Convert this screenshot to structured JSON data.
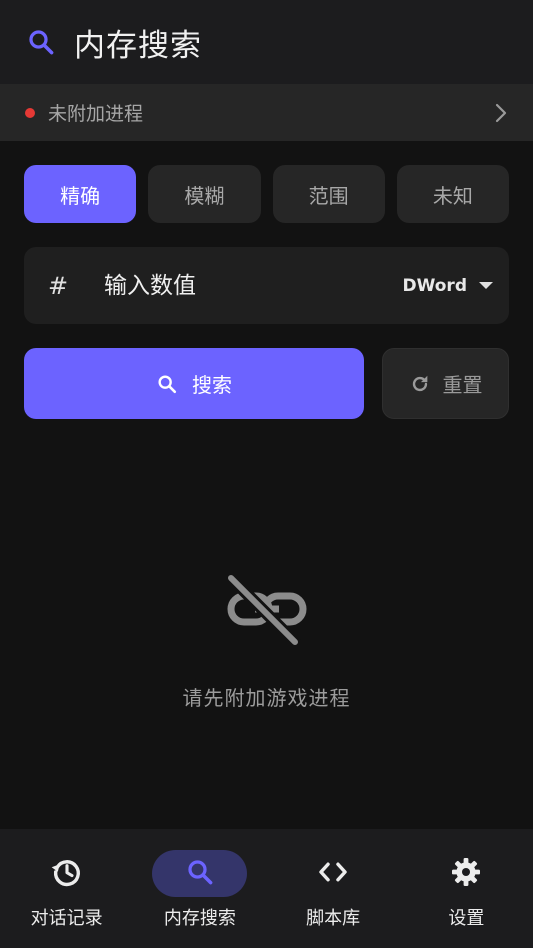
{
  "colors": {
    "accent": "#6c63ff",
    "status_dot": "#e53935",
    "nav_active_bg": "#34356a"
  },
  "header": {
    "title": "内存搜索",
    "icon": "search-icon"
  },
  "status_bar": {
    "text": "未附加进程",
    "icon": "chevron-right-icon"
  },
  "modes": {
    "selected": "精确",
    "items": [
      {
        "label": "精确"
      },
      {
        "label": "模糊"
      },
      {
        "label": "范围"
      },
      {
        "label": "未知"
      }
    ]
  },
  "value_input": {
    "prefix": "#",
    "placeholder": "输入数值",
    "value": "",
    "type": "DWord"
  },
  "actions": {
    "search_label": "搜索",
    "reset_label": "重置"
  },
  "empty_state": {
    "icon": "link-off-icon",
    "message": "请先附加游戏进程"
  },
  "bottom_nav": {
    "active": "内存搜索",
    "items": [
      {
        "label": "对话记录",
        "icon": "history-icon"
      },
      {
        "label": "内存搜索",
        "icon": "search-icon"
      },
      {
        "label": "脚本库",
        "icon": "code-icon"
      },
      {
        "label": "设置",
        "icon": "gear-icon"
      }
    ]
  }
}
